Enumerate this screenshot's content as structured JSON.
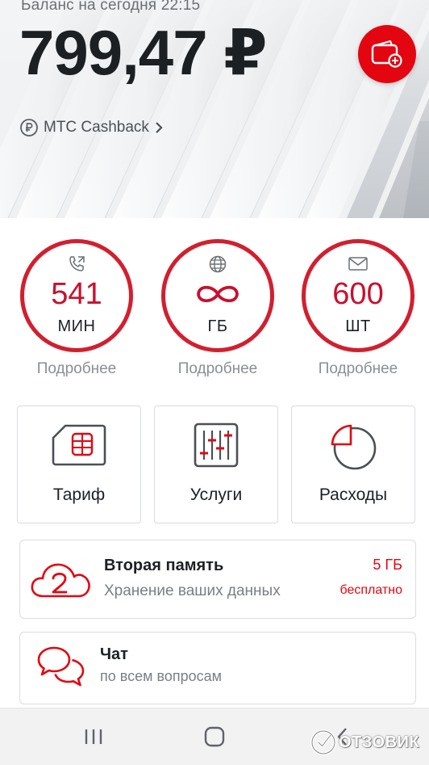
{
  "header": {
    "balance_caption": "Баланс на сегодня 22:15",
    "balance_amount": "799,47 ₽",
    "wallet_icon": "wallet-plus-icon",
    "cashback_label": "МТС Cashback",
    "cashback_icon": "ruble-coin-icon",
    "chevron_icon": "chevron-right-icon"
  },
  "remains": [
    {
      "icon": "phone-icon",
      "value": "541",
      "unit": "МИН",
      "link": "Подробнее"
    },
    {
      "icon": "globe-icon",
      "value": "∞",
      "unit": "ГБ",
      "link": "Подробнее"
    },
    {
      "icon": "envelope-icon",
      "value": "600",
      "unit": "ШТ",
      "link": "Подробнее"
    }
  ],
  "tiles": [
    {
      "icon": "sim-card-icon",
      "label": "Тариф"
    },
    {
      "icon": "sliders-icon",
      "label": "Услуги"
    },
    {
      "icon": "pie-chart-icon",
      "label": "Расходы"
    }
  ],
  "storage_card": {
    "icon": "cloud-2-icon",
    "title": "Вторая память",
    "subtitle": "Хранение ваших данных",
    "amount": "5 ГБ",
    "price": "бесплатно"
  },
  "chat_card": {
    "icon": "chat-bubbles-icon",
    "title": "Чат",
    "subtitle": "по всем вопросам"
  },
  "navbar": {
    "recent_icon": "recent-apps-icon",
    "home_icon": "home-icon",
    "back_icon": "back-icon"
  },
  "watermark": {
    "text": "ОТЗОВИК",
    "icon": "otzovik-logo-icon"
  },
  "colors": {
    "brand_red": "#e30611",
    "ring_red": "#d21f2f",
    "text_dark": "#1d2023",
    "text_muted": "#8a8f94"
  }
}
